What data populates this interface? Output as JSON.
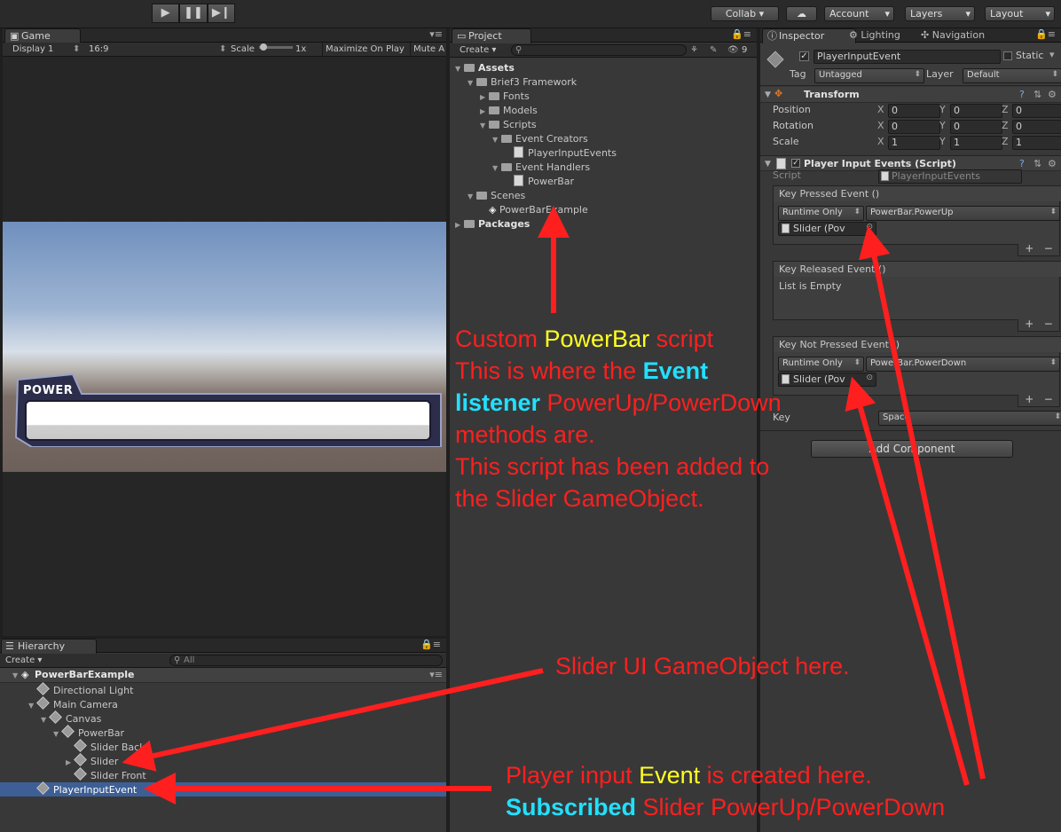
{
  "toolbar": {
    "play_icon": "play-icon",
    "pause_icon": "pause-icon",
    "step_icon": "step-icon",
    "collab": "Collab ▾",
    "account": "Account",
    "layers": "Layers",
    "layout": "Layout"
  },
  "game": {
    "tab": "Game",
    "display": "Display 1",
    "aspect": "16:9",
    "scale_label": "Scale",
    "scale_value": "1x",
    "maximize": "Maximize On Play",
    "mute": "Mute A",
    "power_label": "POWER"
  },
  "project": {
    "tab": "Project",
    "create": "Create ▾",
    "count": "9",
    "tree": [
      {
        "label": "Assets",
        "indent": 0,
        "kind": "folder",
        "bold": true,
        "open": true
      },
      {
        "label": "Brief3 Framework",
        "indent": 1,
        "kind": "folder",
        "open": true
      },
      {
        "label": "Fonts",
        "indent": 2,
        "kind": "folder"
      },
      {
        "label": "Models",
        "indent": 2,
        "kind": "folder"
      },
      {
        "label": "Scripts",
        "indent": 2,
        "kind": "folder",
        "open": true
      },
      {
        "label": "Event Creators",
        "indent": 3,
        "kind": "folder",
        "open": true
      },
      {
        "label": "PlayerInputEvents",
        "indent": 4,
        "kind": "script"
      },
      {
        "label": "Event Handlers",
        "indent": 3,
        "kind": "folder",
        "open": true
      },
      {
        "label": "PowerBar",
        "indent": 4,
        "kind": "script"
      },
      {
        "label": "Scenes",
        "indent": 1,
        "kind": "folder",
        "open": true
      },
      {
        "label": "PowerBarExample",
        "indent": 2,
        "kind": "scene"
      },
      {
        "label": "Packages",
        "indent": 0,
        "kind": "folder",
        "bold": true
      }
    ]
  },
  "hierarchy": {
    "tab": "Hierarchy",
    "create": "Create ▾",
    "search_placeholder": "All",
    "scene": "PowerBarExample",
    "items": [
      {
        "label": "Directional Light",
        "indent": 1
      },
      {
        "label": "Main Camera",
        "indent": 1,
        "open": true
      },
      {
        "label": "Canvas",
        "indent": 2,
        "open": true
      },
      {
        "label": "PowerBar",
        "indent": 3,
        "open": true
      },
      {
        "label": "Slider Back",
        "indent": 4
      },
      {
        "label": "Slider",
        "indent": 4,
        "closed": true
      },
      {
        "label": "Slider Front",
        "indent": 4
      },
      {
        "label": "PlayerInputEvent",
        "indent": 1,
        "selected": true
      }
    ]
  },
  "inspector": {
    "tabs": [
      "Inspector",
      "Lighting",
      "Navigation"
    ],
    "object_name": "PlayerInputEvent",
    "static": "Static",
    "tag_label": "Tag",
    "tag_value": "Untagged",
    "layer_label": "Layer",
    "layer_value": "Default",
    "transform": {
      "title": "Transform",
      "rows": [
        {
          "label": "Position",
          "x": "0",
          "y": "0",
          "z": "0"
        },
        {
          "label": "Rotation",
          "x": "0",
          "y": "0",
          "z": "0"
        },
        {
          "label": "Scale",
          "x": "1",
          "y": "1",
          "z": "1"
        }
      ]
    },
    "script_component": {
      "title": "Player Input Events (Script)",
      "script_label": "Script",
      "script_value": "PlayerInputEvents",
      "key_pressed": "Key Pressed Event ()",
      "key_released": "Key Released Event ()",
      "key_not_pressed": "Key Not Pressed Event ()",
      "runtime": "Runtime Only",
      "power_up": "PowerBar.PowerUp",
      "power_down": "PowerBar.PowerDown",
      "slider_obj": "Slider (Pov",
      "list_empty": "List is Empty",
      "key_label": "Key",
      "key_value": "Space"
    },
    "add_component": "Add Component"
  },
  "annotations": {
    "a1_l1_pre": "Custom ",
    "a1_l1_hi": "PowerBar",
    "a1_l1_post": " script",
    "a1_l2_pre": "This is where the ",
    "a1_l2_hi": "Event",
    "a1_l3_hi": "listener",
    "a1_l3_post": " PowerUp/PowerDown",
    "a1_l4": "methods are.",
    "a1_l5": "This script has been added to",
    "a1_l6": "the Slider GameObject.",
    "a2": "Slider UI GameObject here.",
    "a3_l1_pre": "Player input ",
    "a3_l1_hi": "Event",
    "a3_l1_post": " is created here.",
    "a3_l2_hi": "Subscribed",
    "a3_l2_post": " Slider PowerUp/PowerDown"
  },
  "colors": {
    "annotation_red": "#ff1f1f",
    "highlight_yellow": "#ffff22",
    "highlight_cyan": "#22e0ff",
    "selection_blue": "#3e5f96"
  }
}
